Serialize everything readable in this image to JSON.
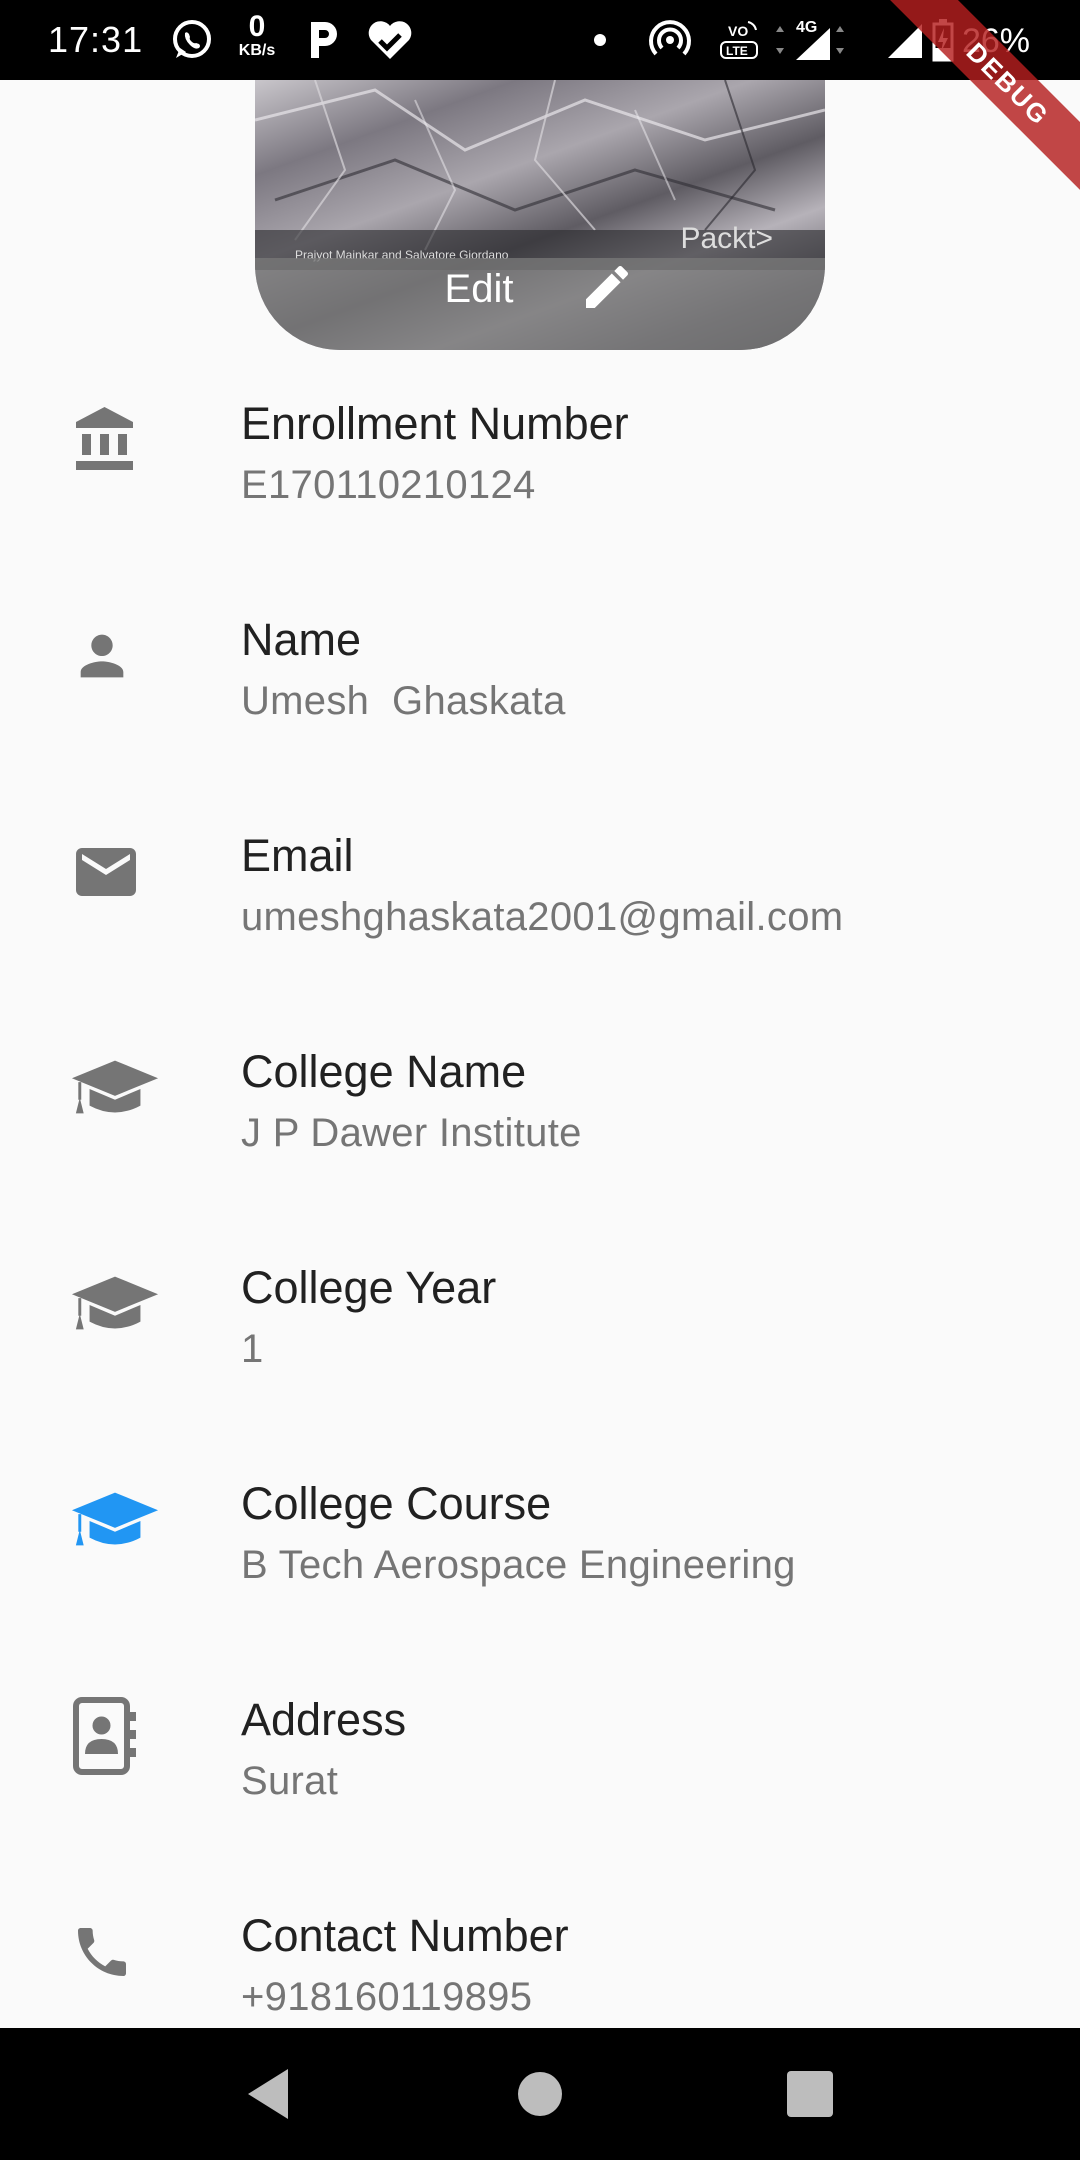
{
  "status_bar": {
    "time": "17:31",
    "data_speed_value": "0",
    "data_speed_unit": "KB/s",
    "battery_percent": "26%",
    "icons": [
      "whatsapp-icon",
      "kbs-indicator",
      "parking-app-icon",
      "heart-check-icon",
      "dot-icon",
      "hotspot-icon",
      "volte-icon",
      "signal-4g-icon",
      "signal-icon",
      "battery-charging-icon"
    ]
  },
  "debug_banner": "DEBUG",
  "profile": {
    "edit_label": "Edit",
    "photo_caption_text": "Prajyot Mainkar and Salvatore Giordano",
    "photo_brand": "Packt>"
  },
  "fields": [
    {
      "icon": "bank-icon",
      "title": "Enrollment Number",
      "value": "E170110210124",
      "icon_color": "#757575"
    },
    {
      "icon": "person-icon",
      "title": "Name",
      "value": "Umesh  Ghaskata",
      "icon_color": "#757575"
    },
    {
      "icon": "email-icon",
      "title": "Email",
      "value": "umeshghaskata2001@gmail.com",
      "icon_color": "#757575"
    },
    {
      "icon": "graduation-cap-icon",
      "title": "College Name",
      "value": "J P Dawer Institute",
      "icon_color": "#757575"
    },
    {
      "icon": "graduation-cap-icon",
      "title": "College Year",
      "value": "1",
      "icon_color": "#757575"
    },
    {
      "icon": "graduation-cap-icon",
      "title": "College Course",
      "value": "B Tech Aerospace Engineering",
      "icon_color": "#2196f3"
    },
    {
      "icon": "contact-book-icon",
      "title": "Address",
      "value": "Surat",
      "icon_color": "#757575"
    },
    {
      "icon": "phone-icon",
      "title": "Contact Number",
      "value": "+918160119895",
      "icon_color": "#757575"
    }
  ],
  "nav_bar": {
    "buttons": [
      "back-icon",
      "home-icon",
      "recents-icon"
    ]
  }
}
